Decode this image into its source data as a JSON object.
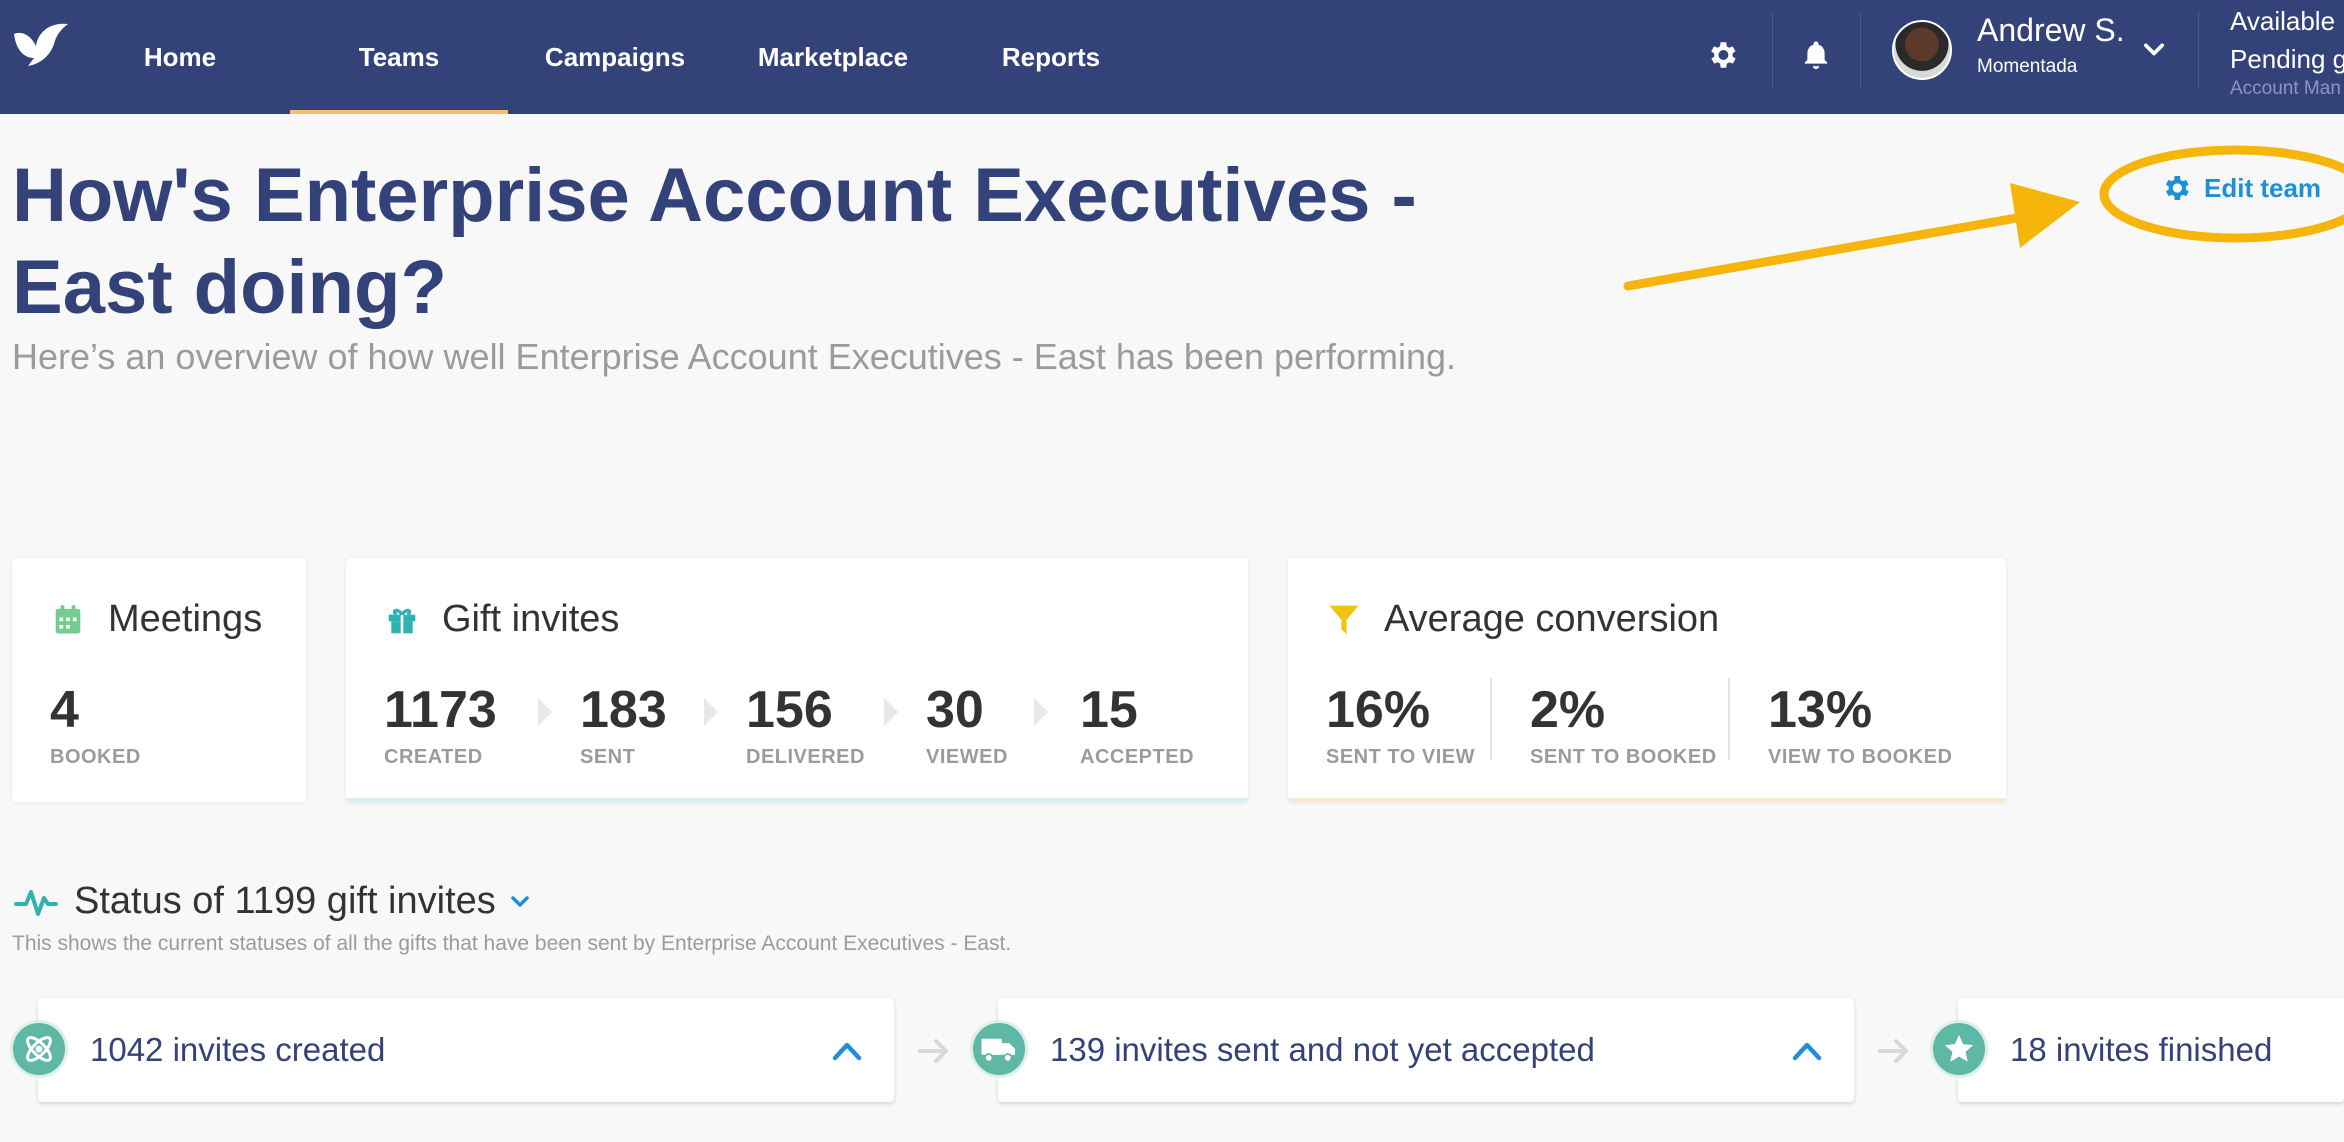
{
  "nav": {
    "items": [
      {
        "label": "Home"
      },
      {
        "label": "Teams"
      },
      {
        "label": "Campaigns"
      },
      {
        "label": "Marketplace"
      },
      {
        "label": "Reports"
      }
    ],
    "active": "Teams",
    "user": {
      "name": "Andrew S.",
      "org": "Momentada"
    },
    "balance": {
      "line1": "Available b",
      "line2": "Pending gi",
      "role": "Account Man"
    },
    "icons": [
      "logo-bird-icon",
      "gear-icon",
      "bell-icon",
      "chevron-down-icon"
    ]
  },
  "page": {
    "title": "How's Enterprise Account Executives - East doing?",
    "subtitle": "Here’s an overview of how well Enterprise Account Executives - East has been performing.",
    "edit_team": "Edit team"
  },
  "cards": {
    "meetings": {
      "title": "Meetings",
      "icon": "calendar-icon",
      "stats": [
        {
          "value": "4",
          "label": "BOOKED"
        }
      ]
    },
    "gift_invites": {
      "title": "Gift invites",
      "icon": "gift-icon",
      "stats": [
        {
          "value": "1173",
          "label": "CREATED"
        },
        {
          "value": "183",
          "label": "SENT"
        },
        {
          "value": "156",
          "label": "DELIVERED"
        },
        {
          "value": "30",
          "label": "VIEWED"
        },
        {
          "value": "15",
          "label": "ACCEPTED"
        }
      ]
    },
    "conversion": {
      "title": "Average conversion",
      "icon": "funnel-icon",
      "stats": [
        {
          "value": "16%",
          "label": "SENT TO VIEW"
        },
        {
          "value": "2%",
          "label": "SENT TO BOOKED"
        },
        {
          "value": "13%",
          "label": "VIEW TO BOOKED"
        }
      ]
    }
  },
  "status": {
    "heading": "Status of 1199 gift invites",
    "description": "This shows the current statuses of all the gifts that have been sent by Enterprise Account Executives - East.",
    "stages": [
      {
        "label": "1042 invites created",
        "icon": "atom-icon"
      },
      {
        "label": "139 invites sent and not yet accepted",
        "icon": "truck-icon"
      },
      {
        "label": "18 invites finished",
        "icon": "star-icon"
      }
    ]
  },
  "colors": {
    "nav_bg": "#34427a",
    "accent_blue": "#1e90d6",
    "annotation": "#f5b50a",
    "teal": "#5fb8a5"
  }
}
